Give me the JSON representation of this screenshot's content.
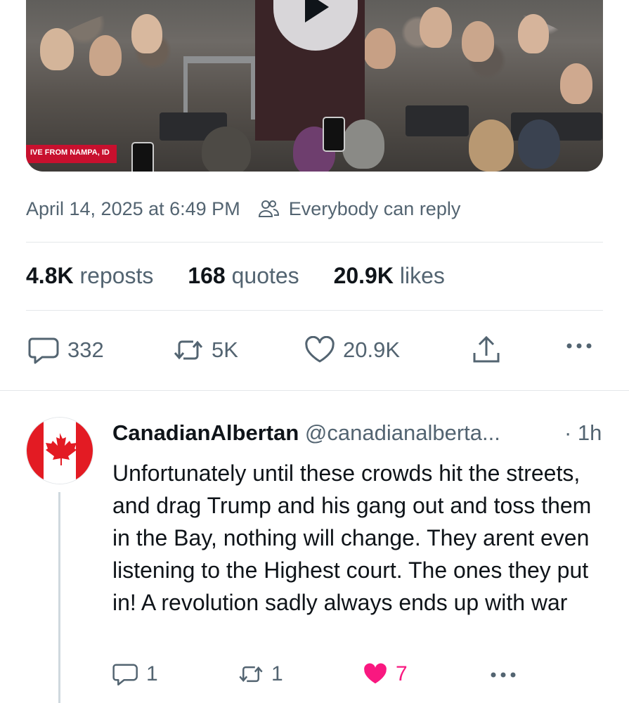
{
  "media": {
    "location_label": "IVE FROM NAMPA, ID"
  },
  "meta": {
    "timestamp": "April 14, 2025 at 6:49 PM",
    "reply_setting": "Everybody can reply"
  },
  "stats": {
    "reposts_count": "4.8K",
    "reposts_label": "reposts",
    "quotes_count": "168",
    "quotes_label": "quotes",
    "likes_count": "20.9K",
    "likes_label": "likes"
  },
  "actions": {
    "replies": "332",
    "reposts": "5K",
    "likes": "20.9K"
  },
  "reply": {
    "name": "CanadianAlbertan",
    "handle": "@canadianalberta...",
    "time": "· 1h",
    "text": "Unfortunately until these crowds hit the streets, and drag Trump and his gang out and toss them in the Bay, nothing will change. They arent even listening to the Highest court. The ones they put in! A revolution sadly always ends up with war",
    "replies": "1",
    "reposts": "1",
    "likes": "7"
  },
  "colors": {
    "text_primary": "#0f1419",
    "text_secondary": "#536471",
    "like_pink": "#f91880",
    "live_red": "#c8102e",
    "flag_red": "#e31b23"
  },
  "icons": {
    "play": "play-icon",
    "people": "people-icon",
    "reply": "reply-icon",
    "repost": "repost-icon",
    "like": "heart-icon",
    "share": "share-icon",
    "more": "more-icon"
  }
}
